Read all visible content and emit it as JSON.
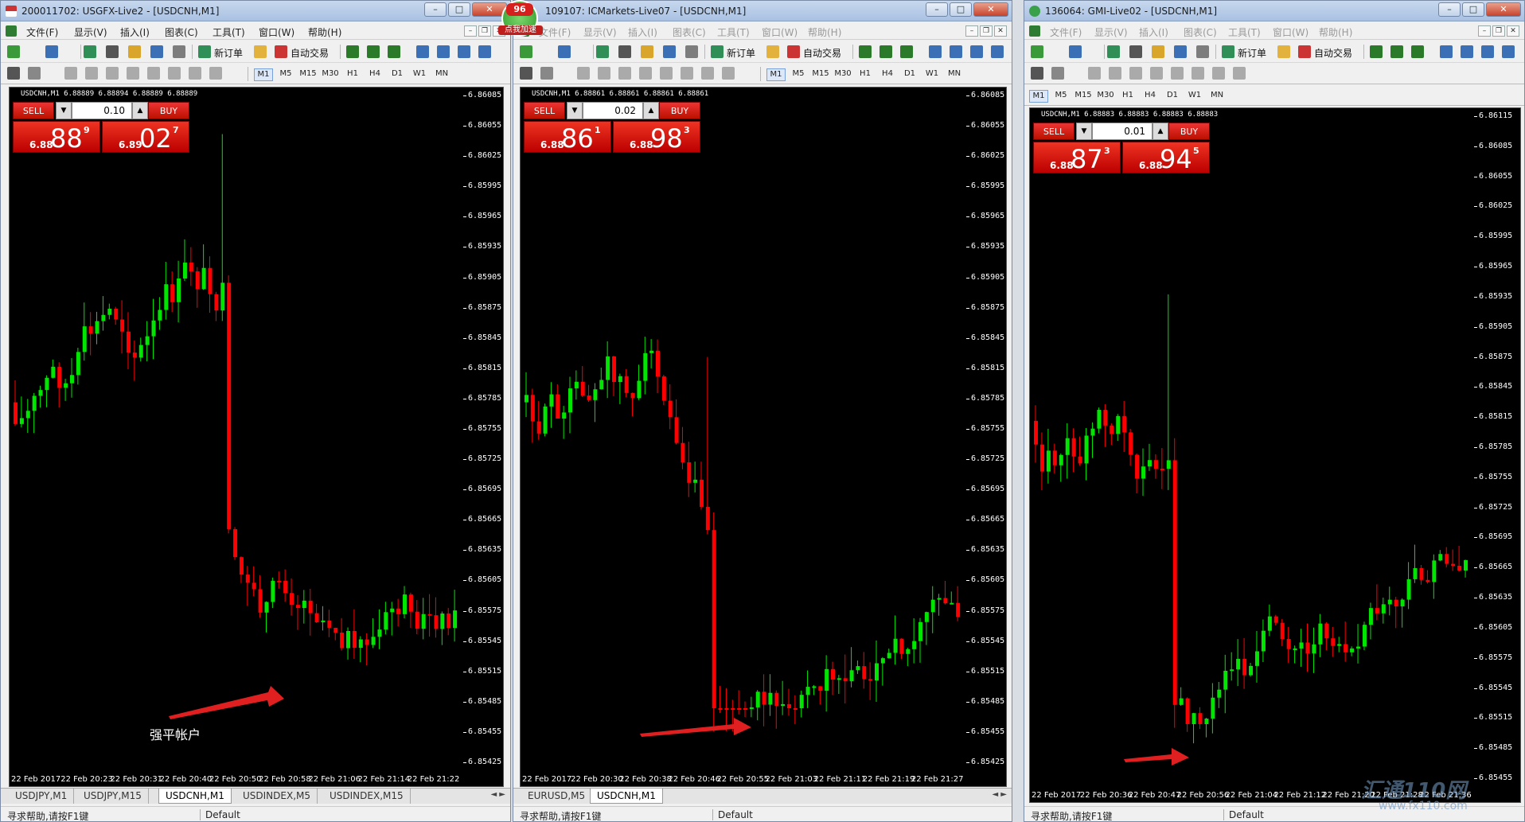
{
  "menu_labels": [
    "文件(F)",
    "显示(V)",
    "插入(I)",
    "图表(C)",
    "工具(T)",
    "窗口(W)",
    "帮助(H)"
  ],
  "toolbar": {
    "new_order": "新订单",
    "auto_trade": "自动交易"
  },
  "timeframes": [
    "M1",
    "M5",
    "M15",
    "M30",
    "H1",
    "H4",
    "D1",
    "W1",
    "MN"
  ],
  "active_timeframe": "M1",
  "colors": {
    "bull": "#00e600",
    "bear": "#ff0000",
    "chart_bg": "#000000",
    "trade_red": "#d51818"
  },
  "badge": {
    "number": "96",
    "text": "点我加速"
  },
  "watermark": {
    "logo": "汇通110网",
    "url": "www.fx110.com"
  },
  "windows": [
    {
      "title": "200011702: USGFX-Live2 - [USDCNH,M1]",
      "symbol_line": "USDCNH,M1  6.88889 6.88894 6.88889 6.88889",
      "trade": {
        "sell": "SELL",
        "buy": "BUY",
        "lot": "0.10",
        "bid_prefix": "6.88",
        "bid_big": "88",
        "bid_sup": "9",
        "ask_prefix": "6.89",
        "ask_big": "02",
        "ask_sup": "7"
      },
      "y_labels": [
        "6.86085",
        "6.86055",
        "6.86025",
        "6.85995",
        "6.85965",
        "6.85935",
        "6.85905",
        "6.85875",
        "6.85845",
        "6.85815",
        "6.85785",
        "6.85755",
        "6.85725",
        "6.85695",
        "6.85665",
        "6.85635",
        "6.85605",
        "6.85575",
        "6.85545",
        "6.85515",
        "6.85485",
        "6.85455",
        "6.85425"
      ],
      "x_labels": [
        "22 Feb 2017",
        "22 Feb 20:23",
        "22 Feb 20:31",
        "22 Feb 20:40",
        "22 Feb 20:50",
        "22 Feb 20:58",
        "22 Feb 21:06",
        "22 Feb 21:14",
        "22 Feb 21:22"
      ],
      "annotation": "强平帐户",
      "tabs": [
        "USDJPY,M1",
        "USDJPY,M15",
        "USDCNH,M1",
        "USDINDEX,M5",
        "USDINDEX,M15"
      ],
      "active_tab": 2,
      "status_left": "寻求帮助,请按F1键",
      "status_mid": "Default"
    },
    {
      "title": "109107: ICMarkets-Live07 - [USDCNH,M1]",
      "symbol_line": "USDCNH,M1  6.88861 6.88861 6.88861 6.88861",
      "trade": {
        "sell": "SELL",
        "buy": "BUY",
        "lot": "0.02",
        "bid_prefix": "6.88",
        "bid_big": "86",
        "bid_sup": "1",
        "ask_prefix": "6.88",
        "ask_big": "98",
        "ask_sup": "3"
      },
      "y_labels": [
        "6.86085",
        "6.86055",
        "6.86025",
        "6.85995",
        "6.85965",
        "6.85935",
        "6.85905",
        "6.85875",
        "6.85845",
        "6.85815",
        "6.85785",
        "6.85755",
        "6.85725",
        "6.85695",
        "6.85665",
        "6.85635",
        "6.85605",
        "6.85575",
        "6.85545",
        "6.85515",
        "6.85485",
        "6.85455",
        "6.85425"
      ],
      "x_labels": [
        "22 Feb 2017",
        "22 Feb 20:30",
        "22 Feb 20:38",
        "22 Feb 20:46",
        "22 Feb 20:55",
        "22 Feb 21:03",
        "22 Feb 21:11",
        "22 Feb 21:19",
        "22 Feb 21:27"
      ],
      "tabs": [
        "EURUSD,M5",
        "USDCNH,M1"
      ],
      "active_tab": 1,
      "status_left": "寻求帮助,请按F1键",
      "status_mid": "Default"
    },
    {
      "title": "136064: GMI-Live02 - [USDCNH,M1]",
      "symbol_line": "USDCNH,M1  6.88883 6.88883 6.88883 6.88883",
      "trade": {
        "sell": "SELL",
        "buy": "BUY",
        "lot": "0.01",
        "bid_prefix": "6.88",
        "bid_big": "87",
        "bid_sup": "3",
        "ask_prefix": "6.88",
        "ask_big": "94",
        "ask_sup": "5"
      },
      "y_labels": [
        "6.86115",
        "6.86085",
        "6.86055",
        "6.86025",
        "6.85995",
        "6.85965",
        "6.85935",
        "6.85905",
        "6.85875",
        "6.85845",
        "6.85815",
        "6.85785",
        "6.85755",
        "6.85725",
        "6.85695",
        "6.85665",
        "6.85635",
        "6.85605",
        "6.85575",
        "6.85545",
        "6.85515",
        "6.85485",
        "6.85455"
      ],
      "x_labels": [
        "22 Feb 2017",
        "22 Feb 20:36",
        "22 Feb 20:47",
        "22 Feb 20:56",
        "22 Feb 21:04",
        "22 Feb 21:12",
        "22 Feb 21:20",
        "22 Feb 21:28",
        "22 Feb 21:36"
      ],
      "tabs": [],
      "active_tab": -1,
      "status_left": "寻求帮助,请按F1键",
      "status_mid": "Default"
    }
  ]
}
